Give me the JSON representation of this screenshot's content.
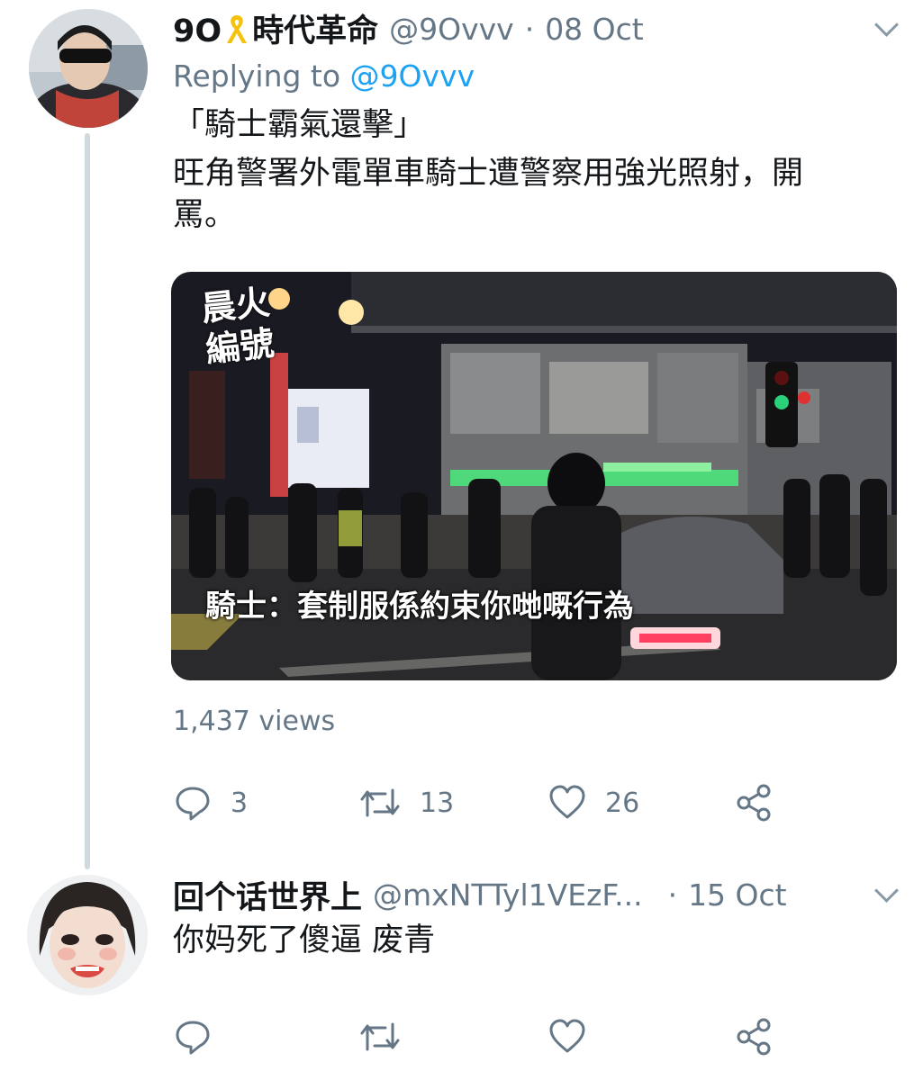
{
  "tweet1": {
    "display_name": "9O",
    "display_name_suffix": "時代革命",
    "handle": "@9Ovvv",
    "separator": "·",
    "date": "08 Oct",
    "replying_prefix": "Replying to",
    "replying_handle": "@9Ovvv",
    "text_line1": "「騎士霸氣還擊」",
    "text_line2": "旺角警署外電單車騎士遭警察用強光照射，開",
    "text_line3": "罵。",
    "video_watermark": "晨火編號",
    "video_caption": "騎士：套制服係約束你哋嘅行為",
    "views": "1,437 views",
    "reply_count": "3",
    "retweet_count": "13",
    "like_count": "26",
    "ribbon_color": "#f4c20d"
  },
  "tweet2": {
    "display_name": "回个话世界上",
    "handle": "@mxNTTyl1VEzF...",
    "separator": "·",
    "date": "15 Oct",
    "text": "你妈死了傻逼 废青"
  },
  "colors": {
    "text": "#14171a",
    "secondary": "#657786",
    "link": "#1da1f2",
    "thread_line": "#cfd9de"
  },
  "icons": [
    "chevron-down-icon",
    "reply-icon",
    "retweet-icon",
    "like-icon",
    "share-icon",
    "yellow-ribbon-icon"
  ]
}
